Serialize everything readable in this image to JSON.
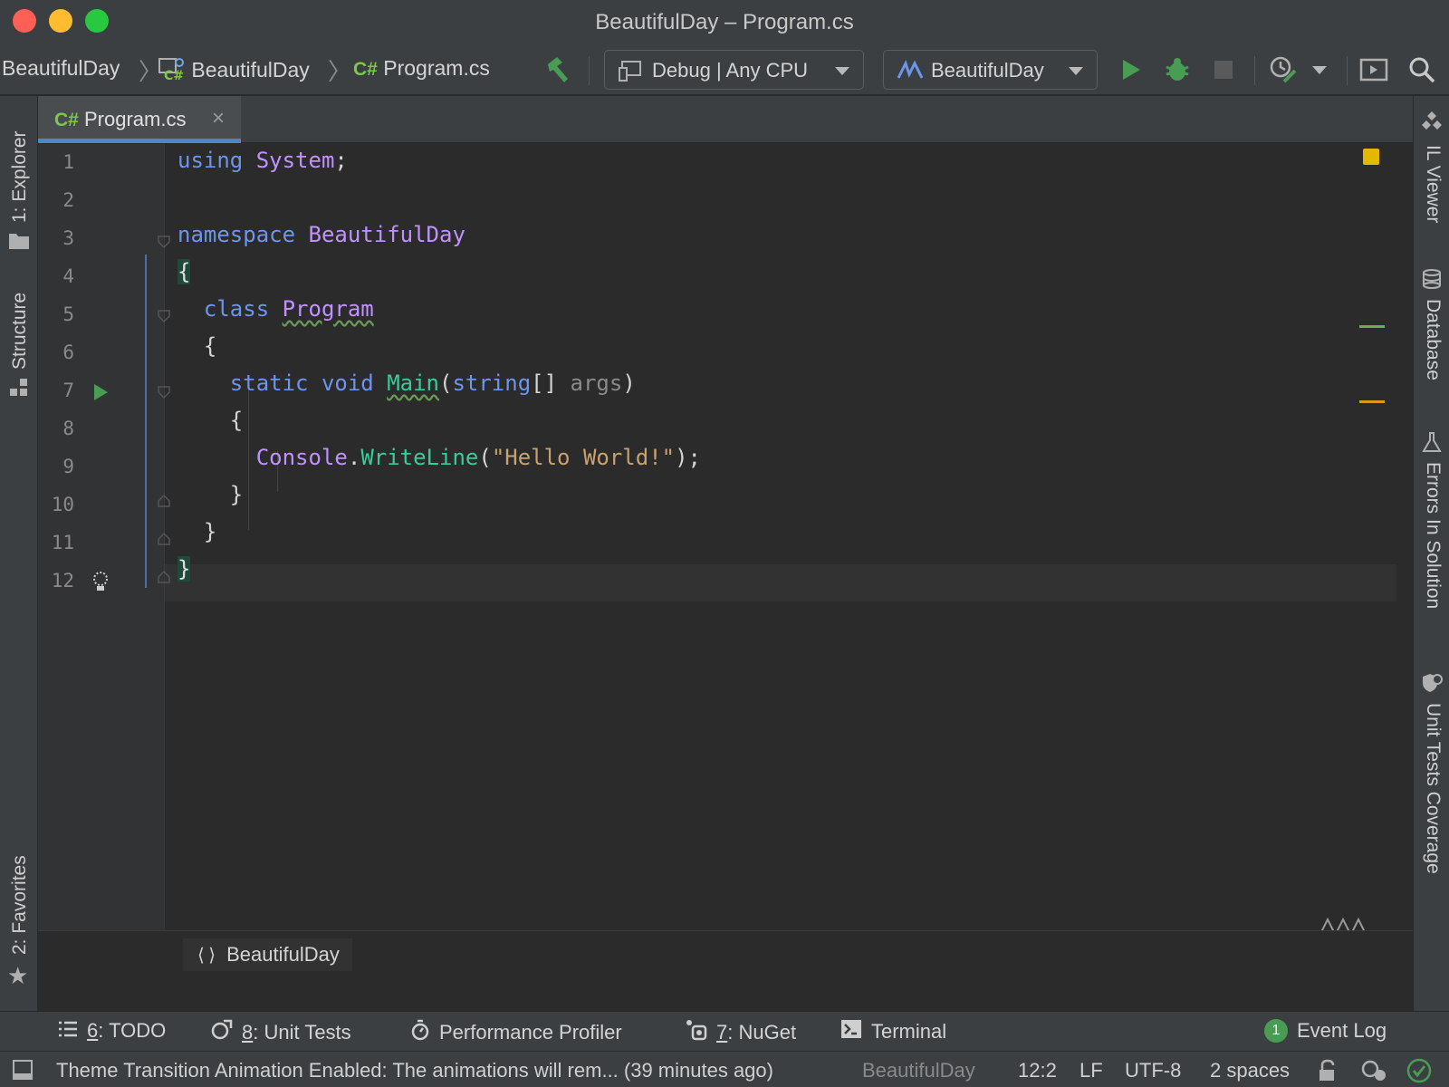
{
  "window": {
    "title": "BeautifulDay – Program.cs"
  },
  "navbar": {
    "crumbs": [
      "BeautifulDay",
      "BeautifulDay",
      "Program.cs"
    ],
    "cs_glyph": "C#",
    "build_icon": "hammer-icon",
    "config_dropdown": "Debug | Any CPU",
    "run_config_dropdown": "BeautifulDay",
    "actions": [
      "run-icon",
      "debug-icon",
      "stop-icon",
      "coverage-icon",
      "run-anything-icon",
      "search-icon"
    ]
  },
  "tabs": [
    {
      "label": "Program.cs",
      "icon": "csharp-file-icon",
      "active": true
    }
  ],
  "left_panels": [
    "1: Explorer",
    "Structure",
    "2: Favorites"
  ],
  "right_panels": [
    "IL Viewer",
    "Database",
    "Errors In Solution",
    "Unit Tests Coverage"
  ],
  "editor": {
    "line_numbers": [
      "1",
      "2",
      "3",
      "4",
      "5",
      "6",
      "7",
      "8",
      "9",
      "10",
      "11",
      "12"
    ],
    "lines": {
      "l1_kw": "using",
      "l1_ns": "System",
      "l1_end": ";",
      "l3_kw": "namespace",
      "l3_name": "BeautifulDay",
      "l4_brace": "{",
      "l5_kw": "class",
      "l5_name": "Program",
      "l6_brace": "{",
      "l7_kw1": "static",
      "l7_kw2": "void",
      "l7_method": "Main",
      "l7_open": "(",
      "l7_type": "string",
      "l7_arr": "[] ",
      "l7_param": "args",
      "l7_close": ")",
      "l8_brace": "{",
      "l9_class": "Console",
      "l9_dot": ".",
      "l9_method": "WriteLine",
      "l9_open": "(",
      "l9_str": "\"Hello World!\"",
      "l9_end": ");",
      "l10_brace": "}",
      "l11_brace": "}",
      "l12_brace": "}"
    },
    "breadcrumb": "BeautifulDay",
    "breadcrumb_icon": "namespace-braces-icon"
  },
  "tool_windows": {
    "todo": {
      "num": "6",
      "label": ": TODO"
    },
    "unit_tests": {
      "num": "8",
      "label": ": Unit Tests"
    },
    "profiler": "Performance Profiler",
    "nuget": {
      "num": "7",
      "label": ": NuGet"
    },
    "terminal": "Terminal",
    "event_log": {
      "count": "1",
      "label": "Event Log"
    }
  },
  "status": {
    "message": "Theme Transition Animation Enabled: The animations will rem... (39 minutes ago)",
    "project": "BeautifulDay",
    "position": "12:2",
    "line_sep": "LF",
    "encoding": "UTF-8",
    "indent": "2 spaces"
  },
  "colors": {
    "accent": "#4a88c7",
    "run_green": "#499c54",
    "keyword": "#6c95eb",
    "type": "#c191ff",
    "method": "#39cc9b",
    "string": "#c9a26d"
  }
}
